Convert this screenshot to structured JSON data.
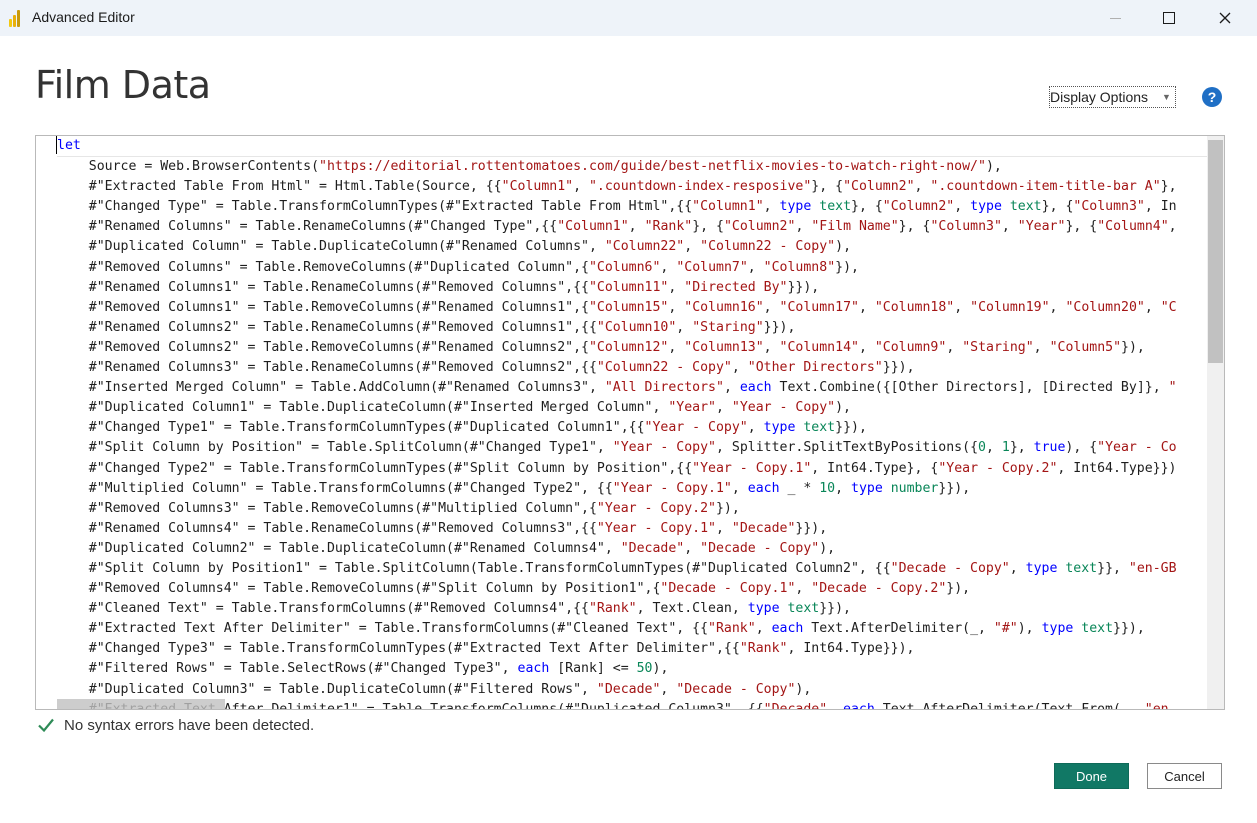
{
  "window": {
    "title": "Advanced Editor",
    "logo_colors": [
      "#f2c811",
      "#e8b00c",
      "#c99a0a"
    ]
  },
  "header": {
    "title": "Film Data",
    "display_options_label": "Display Options",
    "help_label": "?"
  },
  "editor": {
    "lines": [
      [
        [
          "kw",
          "let"
        ]
      ],
      [
        [
          "p",
          "    Source = Web.BrowserContents("
        ],
        [
          "str",
          "\"https://editorial.rottentomatoes.com/guide/best-netflix-movies-to-watch-right-now/\""
        ],
        [
          "p",
          "),"
        ]
      ],
      [
        [
          "p",
          "    #\"Extracted Table From Html\" = Html.Table(Source, {{"
        ],
        [
          "str",
          "\"Column1\""
        ],
        [
          "p",
          ", "
        ],
        [
          "str",
          "\".countdown-index-resposive\""
        ],
        [
          "p",
          "}, {"
        ],
        [
          "str",
          "\"Column2\""
        ],
        [
          "p",
          ", "
        ],
        [
          "str",
          "\".countdown-item-title-bar A\""
        ],
        [
          "p",
          "},"
        ]
      ],
      [
        [
          "p",
          "    #\"Changed Type\" = Table.TransformColumnTypes(#\"Extracted Table From Html\",{{"
        ],
        [
          "str",
          "\"Column1\""
        ],
        [
          "p",
          ", "
        ],
        [
          "kw",
          "type"
        ],
        [
          "p",
          " "
        ],
        [
          "typ",
          "text"
        ],
        [
          "p",
          "}, {"
        ],
        [
          "str",
          "\"Column2\""
        ],
        [
          "p",
          ", "
        ],
        [
          "kw",
          "type"
        ],
        [
          "p",
          " "
        ],
        [
          "typ",
          "text"
        ],
        [
          "p",
          "}, {"
        ],
        [
          "str",
          "\"Column3\""
        ],
        [
          "p",
          ", In"
        ]
      ],
      [
        [
          "p",
          "    #\"Renamed Columns\" = Table.RenameColumns(#\"Changed Type\",{{"
        ],
        [
          "str",
          "\"Column1\""
        ],
        [
          "p",
          ", "
        ],
        [
          "str",
          "\"Rank\""
        ],
        [
          "p",
          "}, {"
        ],
        [
          "str",
          "\"Column2\""
        ],
        [
          "p",
          ", "
        ],
        [
          "str",
          "\"Film Name\""
        ],
        [
          "p",
          "}, {"
        ],
        [
          "str",
          "\"Column3\""
        ],
        [
          "p",
          ", "
        ],
        [
          "str",
          "\"Year\""
        ],
        [
          "p",
          "}, {"
        ],
        [
          "str",
          "\"Column4\""
        ],
        [
          "p",
          ","
        ]
      ],
      [
        [
          "p",
          "    #\"Duplicated Column\" = Table.DuplicateColumn(#\"Renamed Columns\", "
        ],
        [
          "str",
          "\"Column22\""
        ],
        [
          "p",
          ", "
        ],
        [
          "str",
          "\"Column22 - Copy\""
        ],
        [
          "p",
          "),"
        ]
      ],
      [
        [
          "p",
          "    #\"Removed Columns\" = Table.RemoveColumns(#\"Duplicated Column\",{"
        ],
        [
          "str",
          "\"Column6\""
        ],
        [
          "p",
          ", "
        ],
        [
          "str",
          "\"Column7\""
        ],
        [
          "p",
          ", "
        ],
        [
          "str",
          "\"Column8\""
        ],
        [
          "p",
          "}),"
        ]
      ],
      [
        [
          "p",
          "    #\"Renamed Columns1\" = Table.RenameColumns(#\"Removed Columns\",{{"
        ],
        [
          "str",
          "\"Column11\""
        ],
        [
          "p",
          ", "
        ],
        [
          "str",
          "\"Directed By\""
        ],
        [
          "p",
          "}}),"
        ]
      ],
      [
        [
          "p",
          "    #\"Removed Columns1\" = Table.RemoveColumns(#\"Renamed Columns1\",{"
        ],
        [
          "str",
          "\"Column15\""
        ],
        [
          "p",
          ", "
        ],
        [
          "str",
          "\"Column16\""
        ],
        [
          "p",
          ", "
        ],
        [
          "str",
          "\"Column17\""
        ],
        [
          "p",
          ", "
        ],
        [
          "str",
          "\"Column18\""
        ],
        [
          "p",
          ", "
        ],
        [
          "str",
          "\"Column19\""
        ],
        [
          "p",
          ", "
        ],
        [
          "str",
          "\"Column20\""
        ],
        [
          "p",
          ", "
        ],
        [
          "str",
          "\"C"
        ]
      ],
      [
        [
          "p",
          "    #\"Renamed Columns2\" = Table.RenameColumns(#\"Removed Columns1\",{{"
        ],
        [
          "str",
          "\"Column10\""
        ],
        [
          "p",
          ", "
        ],
        [
          "str",
          "\"Staring\""
        ],
        [
          "p",
          "}}),"
        ]
      ],
      [
        [
          "p",
          "    #\"Removed Columns2\" = Table.RemoveColumns(#\"Renamed Columns2\",{"
        ],
        [
          "str",
          "\"Column12\""
        ],
        [
          "p",
          ", "
        ],
        [
          "str",
          "\"Column13\""
        ],
        [
          "p",
          ", "
        ],
        [
          "str",
          "\"Column14\""
        ],
        [
          "p",
          ", "
        ],
        [
          "str",
          "\"Column9\""
        ],
        [
          "p",
          ", "
        ],
        [
          "str",
          "\"Staring\""
        ],
        [
          "p",
          ", "
        ],
        [
          "str",
          "\"Column5\""
        ],
        [
          "p",
          "}),"
        ]
      ],
      [
        [
          "p",
          "    #\"Renamed Columns3\" = Table.RenameColumns(#\"Removed Columns2\",{{"
        ],
        [
          "str",
          "\"Column22 - Copy\""
        ],
        [
          "p",
          ", "
        ],
        [
          "str",
          "\"Other Directors\""
        ],
        [
          "p",
          "}}),"
        ]
      ],
      [
        [
          "p",
          "    #\"Inserted Merged Column\" = Table.AddColumn(#\"Renamed Columns3\", "
        ],
        [
          "str",
          "\"All Directors\""
        ],
        [
          "p",
          ", "
        ],
        [
          "kw",
          "each"
        ],
        [
          "p",
          " Text.Combine({[Other Directors], [Directed By]}, "
        ],
        [
          "str",
          "\""
        ]
      ],
      [
        [
          "p",
          "    #\"Duplicated Column1\" = Table.DuplicateColumn(#\"Inserted Merged Column\", "
        ],
        [
          "str",
          "\"Year\""
        ],
        [
          "p",
          ", "
        ],
        [
          "str",
          "\"Year - Copy\""
        ],
        [
          "p",
          "),"
        ]
      ],
      [
        [
          "p",
          "    #\"Changed Type1\" = Table.TransformColumnTypes(#\"Duplicated Column1\",{{"
        ],
        [
          "str",
          "\"Year - Copy\""
        ],
        [
          "p",
          ", "
        ],
        [
          "kw",
          "type"
        ],
        [
          "p",
          " "
        ],
        [
          "typ",
          "text"
        ],
        [
          "p",
          "}}),"
        ]
      ],
      [
        [
          "p",
          "    #\"Split Column by Position\" = Table.SplitColumn(#\"Changed Type1\", "
        ],
        [
          "str",
          "\"Year - Copy\""
        ],
        [
          "p",
          ", Splitter.SplitTextByPositions({"
        ],
        [
          "num",
          "0"
        ],
        [
          "p",
          ", "
        ],
        [
          "num",
          "1"
        ],
        [
          "p",
          "}, "
        ],
        [
          "kw",
          "true"
        ],
        [
          "p",
          "), {"
        ],
        [
          "str",
          "\"Year - Co"
        ]
      ],
      [
        [
          "p",
          "    #\"Changed Type2\" = Table.TransformColumnTypes(#\"Split Column by Position\",{{"
        ],
        [
          "str",
          "\"Year - Copy.1\""
        ],
        [
          "p",
          ", Int64.Type}, {"
        ],
        [
          "str",
          "\"Year - Copy.2\""
        ],
        [
          "p",
          ", Int64.Type}})"
        ]
      ],
      [
        [
          "p",
          "    #\"Multiplied Column\" = Table.TransformColumns(#\"Changed Type2\", {{"
        ],
        [
          "str",
          "\"Year - Copy.1\""
        ],
        [
          "p",
          ", "
        ],
        [
          "kw",
          "each"
        ],
        [
          "p",
          " _ * "
        ],
        [
          "num",
          "10"
        ],
        [
          "p",
          ", "
        ],
        [
          "kw",
          "type"
        ],
        [
          "p",
          " "
        ],
        [
          "typ",
          "number"
        ],
        [
          "p",
          "}}),"
        ]
      ],
      [
        [
          "p",
          "    #\"Removed Columns3\" = Table.RemoveColumns(#\"Multiplied Column\",{"
        ],
        [
          "str",
          "\"Year - Copy.2\""
        ],
        [
          "p",
          "}),"
        ]
      ],
      [
        [
          "p",
          "    #\"Renamed Columns4\" = Table.RenameColumns(#\"Removed Columns3\",{{"
        ],
        [
          "str",
          "\"Year - Copy.1\""
        ],
        [
          "p",
          ", "
        ],
        [
          "str",
          "\"Decade\""
        ],
        [
          "p",
          "}}),"
        ]
      ],
      [
        [
          "p",
          "    #\"Duplicated Column2\" = Table.DuplicateColumn(#\"Renamed Columns4\", "
        ],
        [
          "str",
          "\"Decade\""
        ],
        [
          "p",
          ", "
        ],
        [
          "str",
          "\"Decade - Copy\""
        ],
        [
          "p",
          "),"
        ]
      ],
      [
        [
          "p",
          "    #\"Split Column by Position1\" = Table.SplitColumn(Table.TransformColumnTypes(#\"Duplicated Column2\", {{"
        ],
        [
          "str",
          "\"Decade - Copy\""
        ],
        [
          "p",
          ", "
        ],
        [
          "kw",
          "type"
        ],
        [
          "p",
          " "
        ],
        [
          "typ",
          "text"
        ],
        [
          "p",
          "}}, "
        ],
        [
          "str",
          "\"en-GB"
        ]
      ],
      [
        [
          "p",
          "    #\"Removed Columns4\" = Table.RemoveColumns(#\"Split Column by Position1\",{"
        ],
        [
          "str",
          "\"Decade - Copy.1\""
        ],
        [
          "p",
          ", "
        ],
        [
          "str",
          "\"Decade - Copy.2\""
        ],
        [
          "p",
          "}),"
        ]
      ],
      [
        [
          "p",
          "    #\"Cleaned Text\" = Table.TransformColumns(#\"Removed Columns4\",{{"
        ],
        [
          "str",
          "\"Rank\""
        ],
        [
          "p",
          ", Text.Clean, "
        ],
        [
          "kw",
          "type"
        ],
        [
          "p",
          " "
        ],
        [
          "typ",
          "text"
        ],
        [
          "p",
          "}}),"
        ]
      ],
      [
        [
          "p",
          "    #\"Extracted Text After Delimiter\" = Table.TransformColumns(#\"Cleaned Text\", {{"
        ],
        [
          "str",
          "\"Rank\""
        ],
        [
          "p",
          ", "
        ],
        [
          "kw",
          "each"
        ],
        [
          "p",
          " Text.AfterDelimiter(_, "
        ],
        [
          "str",
          "\"#\""
        ],
        [
          "p",
          "), "
        ],
        [
          "kw",
          "type"
        ],
        [
          "p",
          " "
        ],
        [
          "typ",
          "text"
        ],
        [
          "p",
          "}}),"
        ]
      ],
      [
        [
          "p",
          "    #\"Changed Type3\" = Table.TransformColumnTypes(#\"Extracted Text After Delimiter\",{{"
        ],
        [
          "str",
          "\"Rank\""
        ],
        [
          "p",
          ", Int64.Type}}),"
        ]
      ],
      [
        [
          "p",
          "    #\"Filtered Rows\" = Table.SelectRows(#\"Changed Type3\", "
        ],
        [
          "kw",
          "each"
        ],
        [
          "p",
          " [Rank] <= "
        ],
        [
          "num",
          "50"
        ],
        [
          "p",
          "),"
        ]
      ],
      [
        [
          "p",
          "    #\"Duplicated Column3\" = Table.DuplicateColumn(#\"Filtered Rows\", "
        ],
        [
          "str",
          "\"Decade\""
        ],
        [
          "p",
          ", "
        ],
        [
          "str",
          "\"Decade - Copy\""
        ],
        [
          "p",
          "),"
        ]
      ],
      [
        [
          "p",
          "    #\"Extracted Text After Delimiter1\" = Table.TransformColumns(#\"Duplicated Column3\", {{"
        ],
        [
          "str",
          "\"Decade\""
        ],
        [
          "p",
          ", "
        ],
        [
          "kw",
          "each"
        ],
        [
          "p",
          " Text.AfterDelimiter(Text.From(_, "
        ],
        [
          "str",
          "\"en"
        ]
      ]
    ]
  },
  "status": {
    "message": "No syntax errors have been detected.",
    "icon": "check-icon",
    "color": "#2e8b57"
  },
  "footer": {
    "done_label": "Done",
    "cancel_label": "Cancel"
  },
  "colors": {
    "accent": "#117865",
    "keyword": "#0000ff",
    "string": "#a31515",
    "type": "#098658"
  }
}
